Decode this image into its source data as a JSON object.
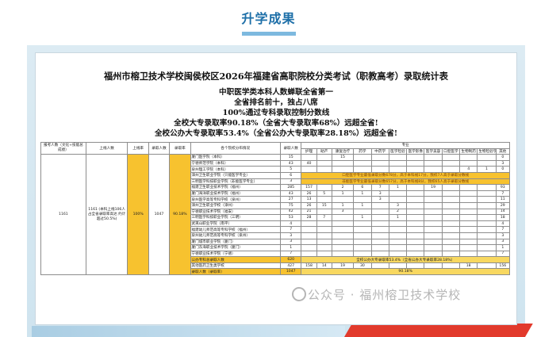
{
  "section_title": "升学成果",
  "doc": {
    "title": "福州市榕卫技术学校闽侯校区2026年福建省高职院校分类考试（职教高考）录取统计表",
    "highlights": [
      "中职医学类本科人数蝉联全省第一",
      "全省排名前十，独占八席",
      "100%通过专科录取控制分数线",
      "全校大专录取率90.18%（全省大专录取率68%）远超全省!",
      "全校公办大专录取率53.4%（全省公办大专录取率28.18%）远超全省!"
    ]
  },
  "table": {
    "headers": {
      "col1": "报考人数（文化+技能总成绩）",
      "col2": "上线人数",
      "col3": "上线率",
      "col4": "录取人数",
      "col5": "录取率",
      "col6": "各个院校分布情况",
      "col7": "录取人数",
      "major": "专业",
      "majors": [
        "护理",
        "助产",
        "康复治疗",
        "药学",
        "中药学",
        "医学检验",
        "医学影像",
        "医学美容",
        "口腔医学",
        "生物制药",
        "生物检验学",
        "其他"
      ]
    },
    "summary": {
      "applicants": "1161",
      "online": "1161 (本科上线106人 占全省录取率高达 约计超过50.5%)",
      "online_rate": "100%",
      "admitted": "1047",
      "admit_rate": "90.18%"
    },
    "rows": [
      {
        "school": "厦门医学院（本科）",
        "total": "15",
        "cells": [
          "",
          "",
          "15",
          "",
          "",
          "",
          "",
          "",
          "",
          "",
          "",
          "0"
        ]
      },
      {
        "school": "宁德师范学院（本科）",
        "total": "43",
        "cells": [
          "40",
          "",
          "",
          "",
          "",
          "",
          "",
          "",
          "",
          "",
          "",
          "3"
        ]
      },
      {
        "school": "泉州理工学院（本科）",
        "total": "5",
        "cells": [
          "",
          "",
          "",
          "",
          "",
          "",
          "",
          "",
          "",
          "4",
          "1",
          "0"
        ]
      },
      {
        "school": "漳州卫生职业学院（只能医学专业）",
        "total": "6",
        "note": "口腔医学专业最低录取分数678分，高于本科线17分，我校7人高于录取分数线"
      },
      {
        "school": "三明医学科技职业学院（非能医学专业）",
        "total": "3",
        "note": "非能医学专业最低录取分数657分，高于本科线8分，我校65人高于录取分数线"
      },
      {
        "school": "福建卫生职业技术学院（福州）",
        "total": "285",
        "cells": [
          "157",
          "",
          "2",
          "6",
          "7",
          "1",
          "",
          "19",
          "",
          "",
          "",
          "93"
        ]
      },
      {
        "school": "厦门海洋职业技术学院（福州）",
        "total": "43",
        "cells": [
          "26",
          "5",
          "1",
          "1",
          "3",
          "",
          "",
          "",
          "",
          "",
          "",
          "7"
        ]
      },
      {
        "school": "泉州医学高等专科学校（泉州）",
        "total": "27",
        "cells": [
          "13",
          "",
          "",
          "",
          "3",
          "",
          "",
          "",
          "",
          "",
          "",
          "11"
        ]
      },
      {
        "school": "漳州卫生职业学校（漳州）",
        "total": "75",
        "cells": [
          "26",
          "15",
          "1",
          "1",
          "",
          "3",
          "",
          "",
          "",
          "",
          "",
          "29"
        ]
      },
      {
        "school": "宁德职业技术学院（福安）",
        "total": "42",
        "cells": [
          "21",
          "",
          "3",
          "",
          "",
          "2",
          "",
          "",
          "",
          "",
          "",
          "14"
        ]
      },
      {
        "school": "三明医学科技职业学院（三明）",
        "total": "53",
        "cells": [
          "28",
          "7",
          "",
          "1",
          "",
          "1",
          "",
          "",
          "",
          "",
          "",
          "18"
        ]
      },
      {
        "school": "武夷山职业学院（南平）",
        "total": "4",
        "cells": [
          "",
          "",
          "",
          "",
          "",
          "",
          "",
          "",
          "",
          "",
          "",
          "4"
        ]
      },
      {
        "school": "福建幼儿师范高等专科学校（福州）",
        "total": "7",
        "cells": [
          "",
          "",
          "",
          "",
          "",
          "",
          "",
          "",
          "",
          "",
          "",
          "7"
        ]
      },
      {
        "school": "泉州幼儿师范高等专科学校（泉州）",
        "total": "3",
        "cells": [
          "",
          "",
          "",
          "",
          "",
          "",
          "",
          "",
          "",
          "",
          "",
          "3"
        ]
      },
      {
        "school": "厦门城市职业学院（厦门）",
        "total": "3",
        "cells": [
          "",
          "",
          "",
          "",
          "",
          "",
          "",
          "",
          "",
          "",
          "",
          "3"
        ]
      },
      {
        "school": "厦门东海职业技术学院（厦门）",
        "total": "1",
        "cells": [
          "",
          "",
          "",
          "",
          "",
          "",
          "",
          "",
          "",
          "",
          "",
          "1"
        ]
      },
      {
        "school": "宁德职业技术学院（宁德）",
        "total": "7",
        "cells": [
          "",
          "",
          "",
          "",
          "",
          "",
          "",
          "",
          "",
          "",
          "",
          "7"
        ]
      }
    ],
    "public_total": {
      "label": "公办专科总录取人数",
      "total": "620",
      "note": "全校公办大专录取率53.4%（全省公办大专录取率28.18%）"
    },
    "private_row": {
      "label": "其他医药卫生类学校",
      "total": "427",
      "cells": [
        "158",
        "14",
        "19",
        "30",
        "",
        "",
        "",
        "",
        "",
        "18",
        "",
        "156"
      ]
    },
    "grand_total": {
      "label": "录取人数（录取率）",
      "total": "1047",
      "rate": "90.18%"
    }
  },
  "watermark": "公众号 · 福州榕卫技术学校"
}
